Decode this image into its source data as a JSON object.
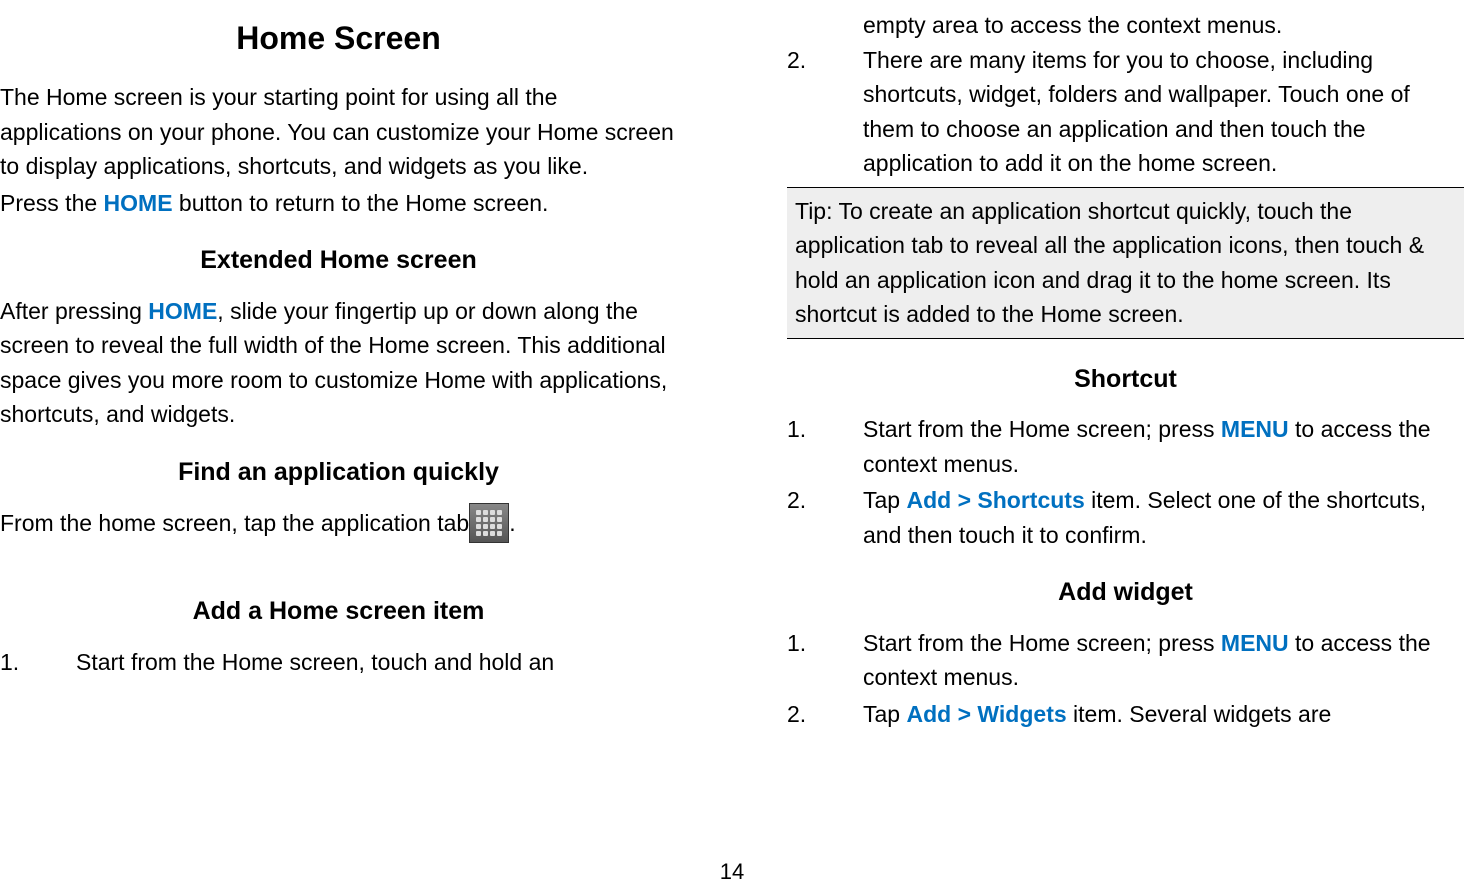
{
  "pageNumber": "14",
  "left": {
    "h1": "Home Screen",
    "p1a": "The Home screen is your starting point for using all the applications on your phone. You can customize your Home screen to display applications, shortcuts, and widgets as you like.",
    "p1b_pre": "Press the ",
    "p1b_highlight": "HOME",
    "p1b_post": " button to return to the Home screen.",
    "h2_extended": "Extended Home screen",
    "p2_pre": "After pressing ",
    "p2_highlight": "HOME",
    "p2_post": ", slide your fingertip up or down along the screen to reveal the full width of the Home screen. This additional space gives you more room to customize Home with applications, shortcuts, and widgets.",
    "h2_find": "Find an application quickly",
    "p3_pre": "From the home screen, tap the application tab",
    "p3_post": ".",
    "h2_add": "Add a Home screen item",
    "ol1_item1": "Start from the Home screen, touch and hold an"
  },
  "right": {
    "cont1": "empty area to access the context menus.",
    "ol1_item2": "There are many items for you to choose, including shortcuts, widget, folders and wallpaper. Touch one of them to choose an application and then touch the application to add it on the home screen.",
    "tip": "Tip: To create an application shortcut quickly, touch the application tab to reveal all the application icons, then touch & hold an application icon and drag it to the home screen. Its shortcut is added to the Home screen.",
    "h2_shortcut": "Shortcut",
    "sc_item1_pre": "Start from the Home screen; press ",
    "sc_item1_highlight": "MENU",
    "sc_item1_post": " to access the context menus.",
    "sc_item2_pre": "Tap ",
    "sc_item2_highlight": "Add > Shortcuts",
    "sc_item2_post": " item. Select one of the shortcuts, and then touch it to confirm.",
    "h2_widget": "Add widget",
    "wg_item1_pre": "Start from the Home screen; press ",
    "wg_item1_highlight": "MENU",
    "wg_item1_post": " to access the context menus.",
    "wg_item2_pre": "Tap ",
    "wg_item2_highlight": "Add > Widgets",
    "wg_item2_post": " item.   Several widgets are"
  }
}
